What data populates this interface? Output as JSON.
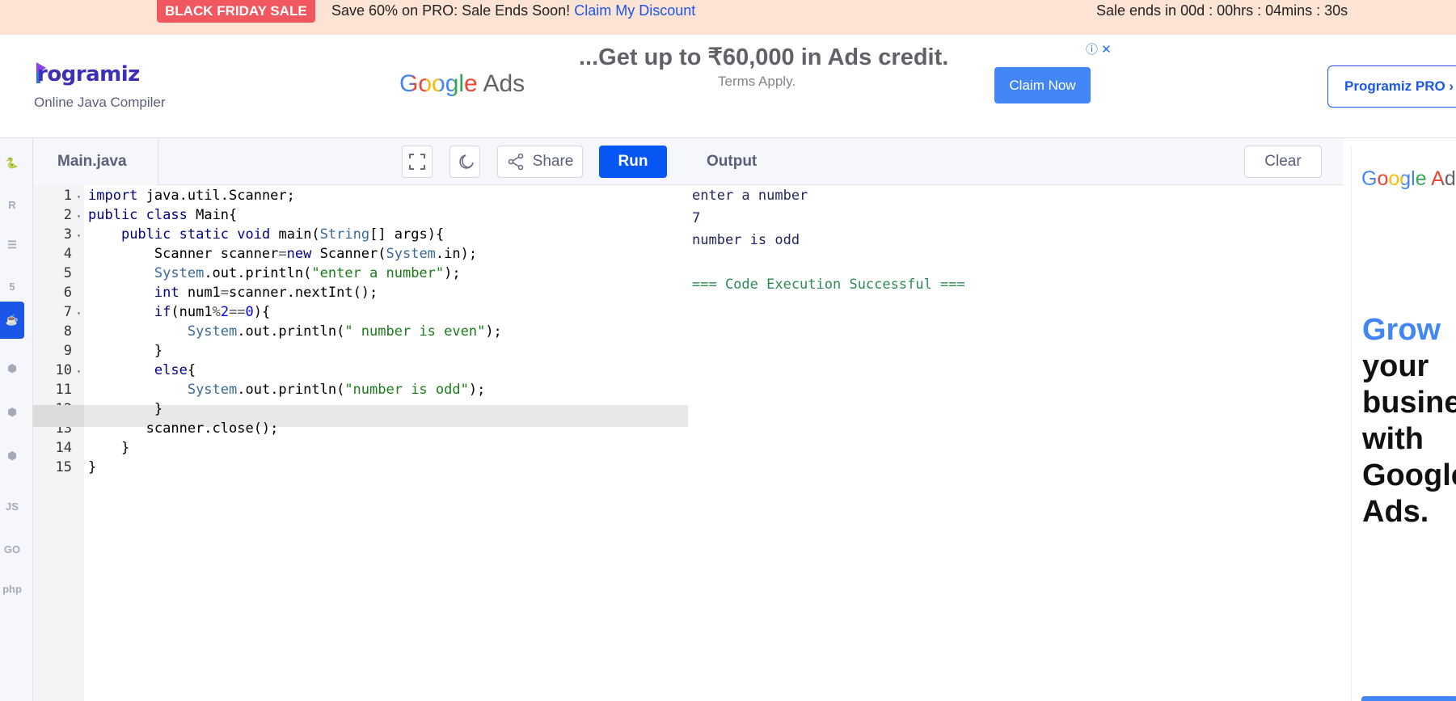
{
  "promo": {
    "badge": "BLACK FRIDAY SALE",
    "message": "Save 60% on PRO: Sale Ends Soon!",
    "link": "Claim My Discount",
    "timer": "Sale ends in 00d : 00hrs : 04mins : 30s"
  },
  "header": {
    "logo": "rogramiz",
    "subtitle": "Online Java Compiler",
    "pro_button": "Programiz PRO ›"
  },
  "ad": {
    "google": "Google",
    "ads": "Ads",
    "headline": "...Get up to ₹60,000 in Ads credit.",
    "terms": "Terms Apply.",
    "cta": "Claim Now",
    "info": "ⓘ ✕"
  },
  "rail": {
    "items": [
      {
        "icon": "python-icon",
        "glyph": "🐍"
      },
      {
        "icon": "r-icon",
        "glyph": "R"
      },
      {
        "icon": "sql-icon",
        "glyph": "☰"
      },
      {
        "icon": "html-icon",
        "glyph": "5"
      },
      {
        "icon": "java-icon",
        "glyph": "☕",
        "active": true
      },
      {
        "icon": "c-icon",
        "glyph": "⬢"
      },
      {
        "icon": "cpp-icon",
        "glyph": "⬢"
      },
      {
        "icon": "csharp-icon",
        "glyph": "⬢"
      },
      {
        "icon": "js-icon",
        "glyph": "JS"
      },
      {
        "icon": "go-icon",
        "glyph": "GO"
      },
      {
        "icon": "php-icon",
        "glyph": "php"
      }
    ]
  },
  "editor": {
    "file_name": "Main.java",
    "share_label": "Share",
    "run_label": "Run",
    "active_line": 11,
    "lines": [
      "1",
      "2",
      "3",
      "4",
      "5",
      "6",
      "7",
      "8",
      "9",
      "10",
      "11",
      "12",
      "13",
      "14",
      "15"
    ]
  },
  "output": {
    "title": "Output",
    "clear_label": "Clear",
    "lines": [
      "enter a number",
      "7",
      "number is odd",
      "",
      "=== Code Execution Successful ==="
    ]
  },
  "side_ad": {
    "google": "Google Ads",
    "line1": "Grow",
    "line2": "your",
    "line3": "busine",
    "line4": "with",
    "line5": "Google",
    "line6": "Ads."
  }
}
